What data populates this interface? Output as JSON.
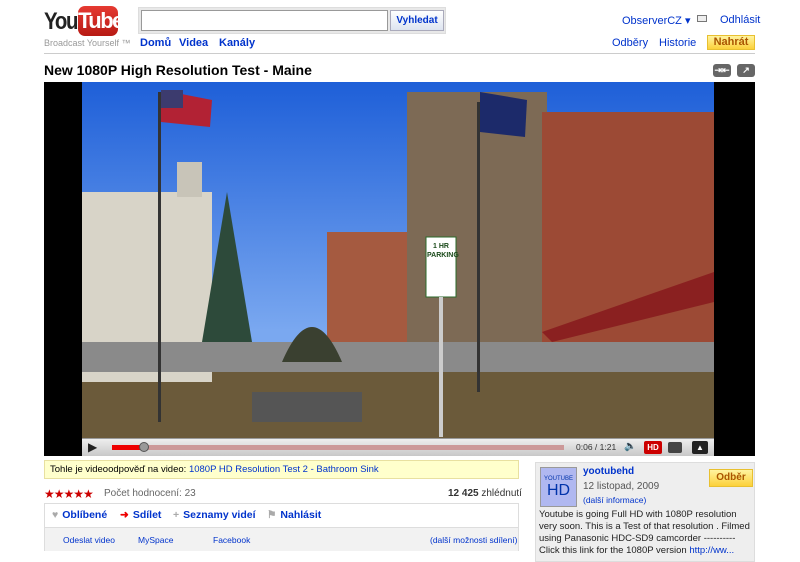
{
  "header": {
    "logo_you": "You",
    "logo_tube": "Tube",
    "slogan": "Broadcast Yourself ™",
    "search_placeholder": "",
    "search_button": "Vyhledat",
    "nav": [
      "Domů",
      "Videa",
      "Kanály"
    ],
    "user": "ObserverCZ ▾",
    "logout": "Odhlásit",
    "subscriptions": "Odběry",
    "history": "Historie",
    "upload": "Nahrát"
  },
  "video": {
    "title": "New 1080P High Resolution Test - Maine",
    "time": "0:06 / 1:21",
    "progress": 0.07,
    "hd": "HD",
    "sign_text": "1 HR PARKING"
  },
  "response": {
    "prefix": "Tohle je videoodpověď na video: ",
    "link": "1080P HD Resolution Test 2 - Bathroom Sink"
  },
  "rating": {
    "stars": "★★★★★",
    "stars_value": 4.5,
    "count_label": "Počet hodnocení: 23",
    "views_num": "12 425",
    "views_label": " zhlédnutí"
  },
  "actions": {
    "favorite": "Oblíbené",
    "share": "Sdílet",
    "playlists": "Seznamy videí",
    "flag": "Nahlásit",
    "share_links": [
      "Odeslat video",
      "MySpace",
      "Facebook",
      "(další možnosti sdílení)"
    ]
  },
  "channel": {
    "name": "yootubehd",
    "date": "12 listopad, 2009",
    "more": "(další informace)",
    "subscribe": "Odběr",
    "thumb_top": "YOUTUBE",
    "thumb_hd": "HD",
    "description": "Youtube is going Full HD with 1080P resolution very soon. This is a Test of that resolution . Filmed using Panasonic HDC-SD9 camcorder ---------- Click this link for the 1080P version ",
    "desc_link": "http://ww..."
  }
}
